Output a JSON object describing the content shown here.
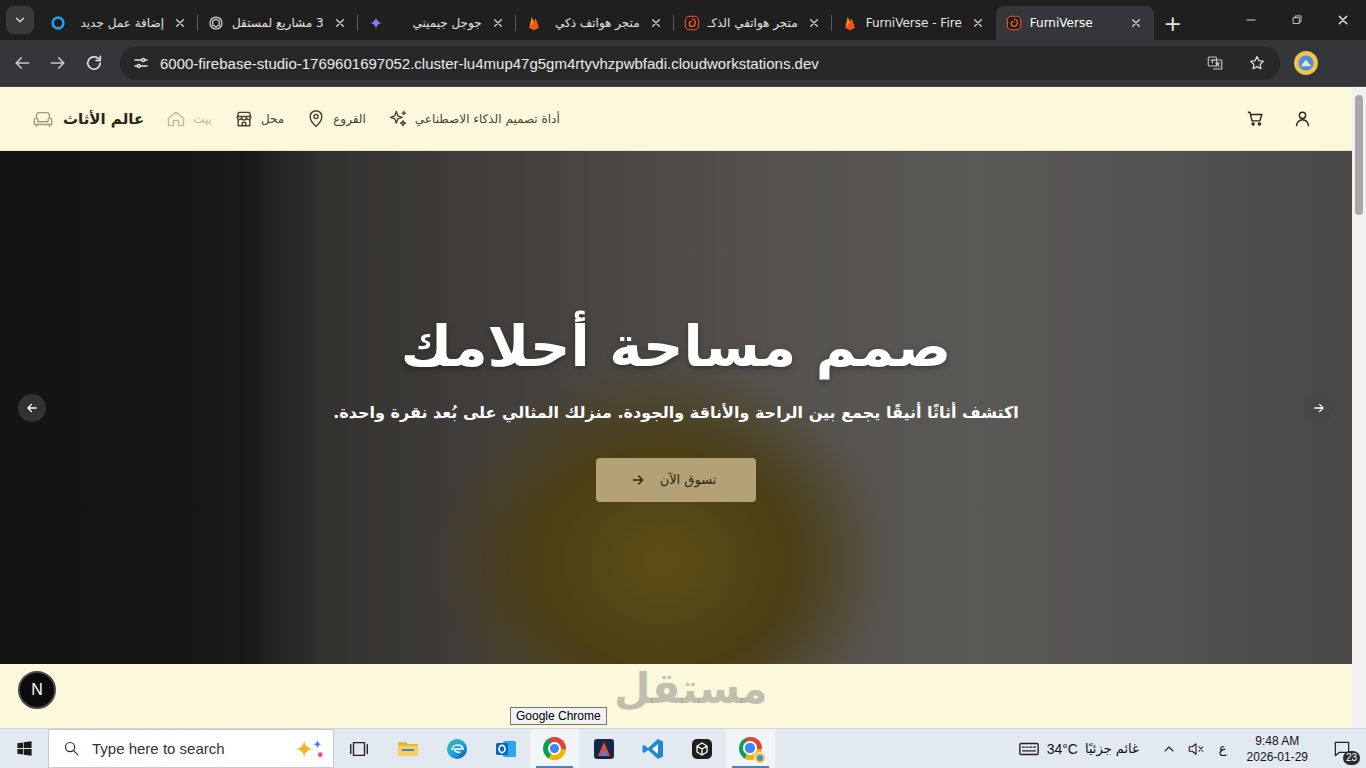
{
  "browser": {
    "tabs": [
      {
        "label": "إضافة عمل جديد",
        "kind": "mostaql",
        "selected": false
      },
      {
        "label": "3 مشاريع لمستقل",
        "kind": "openai",
        "selected": false
      },
      {
        "label": "جوجل جيميني",
        "kind": "gemini",
        "selected": false
      },
      {
        "label": "متجر هواتف ذكي",
        "kind": "firebase",
        "selected": false
      },
      {
        "label": "متجر هواتفي الذكـ",
        "kind": "studio",
        "selected": false
      },
      {
        "label": "FurniVerse - Fire",
        "kind": "firebase",
        "selected": false
      },
      {
        "label": "FurniVerse",
        "kind": "studio",
        "selected": true
      }
    ],
    "new_tab": "+",
    "url": "6000-firebase-studio-1769601697052.cluster-lu4mup47g5gm4rtyvhzpwbfadi.cloudworkstations.dev"
  },
  "site": {
    "logo": "عالم الأثاث",
    "nav": [
      {
        "label": "بيت",
        "kind": "home",
        "selected": true
      },
      {
        "label": "محل",
        "kind": "store",
        "selected": false
      },
      {
        "label": "الفروع",
        "kind": "pin",
        "selected": false
      },
      {
        "label": "أداة تصميم الذكاء الاصطناعي",
        "kind": "sparkles",
        "selected": false
      }
    ],
    "hero": {
      "title": "صمم مساحة أحلامك",
      "subtitle": "اكتشف أثاثًا أنيقًا يجمع بين الراحة والأناقة والجودة. منزلك المثالي على بُعد نقرة واحدة.",
      "cta": "تسوق الآن"
    }
  },
  "overlays": {
    "dev_badge": "N",
    "watermark": "مستقل",
    "tooltip": "Google Chrome"
  },
  "taskbar": {
    "search_placeholder": "Type here to search",
    "apps": [
      {
        "kind": "task-view",
        "active": false
      },
      {
        "kind": "explorer",
        "active": false
      },
      {
        "kind": "edge",
        "active": false
      },
      {
        "kind": "outlook",
        "active": false
      },
      {
        "kind": "chrome",
        "active": true
      },
      {
        "kind": "app",
        "active": false
      },
      {
        "kind": "vscode",
        "active": false
      },
      {
        "kind": "cube",
        "active": false
      },
      {
        "kind": "chrome-profile",
        "active": true
      }
    ],
    "weather": {
      "temp": "34°C",
      "condition": "غائم جزئيًا"
    },
    "language": "ع",
    "time": "9:48 AM",
    "date": "2026-01-29",
    "notifications": "23"
  }
}
